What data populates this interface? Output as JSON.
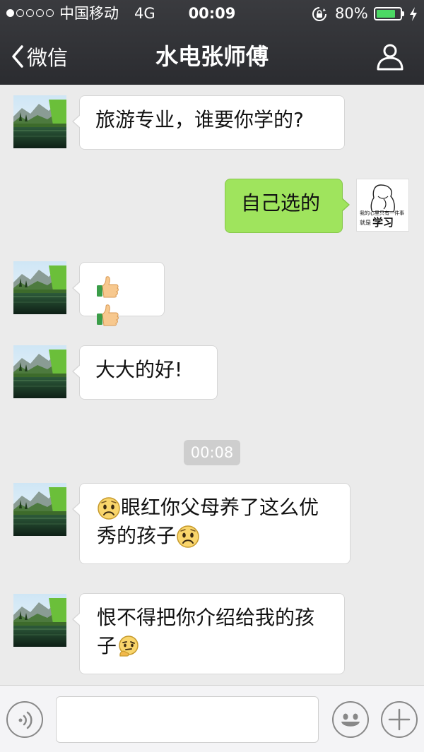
{
  "status_bar": {
    "carrier": "中国移动",
    "network": "4G",
    "time": "00:09",
    "battery": "80%",
    "battery_level": 0.8,
    "signal_dots_filled": 1,
    "signal_dots_total": 5
  },
  "nav": {
    "back_label": "微信",
    "title": "水电张师傅"
  },
  "messages": [
    {
      "side": "in",
      "text": "旅游专业，谁要你学的?"
    },
    {
      "side": "out",
      "text": "自己选的",
      "avatar_caption_small": "我的心里只有一件事",
      "avatar_caption_prefix": "就是",
      "avatar_caption_big": "学习"
    },
    {
      "side": "in",
      "emoji": [
        "thumbs-up",
        "thumbs-up"
      ]
    },
    {
      "side": "in",
      "text": "大大的好!"
    },
    {
      "side": "in",
      "line1_text": "眼红你父母养了这么优",
      "line2_text": "秀的孩子",
      "emoji": [
        "frown",
        "frown"
      ]
    },
    {
      "side": "in",
      "line1_text": "恨不得把你介绍给我的孩",
      "line2_text": "子",
      "emoji": [
        "thinking"
      ]
    }
  ],
  "timestamp_divider": "00:08",
  "input_bar": {
    "voice_icon": "voice-icon",
    "emoji_icon": "emoji-face-icon",
    "plus_icon": "plus-icon",
    "text_value": ""
  },
  "colors": {
    "nav_bg": "#2f3034",
    "chat_bg": "#ebebeb",
    "outgoing_bubble": "#9fe45d",
    "incoming_bubble": "#ffffff",
    "battery_fill": "#4cd964"
  }
}
